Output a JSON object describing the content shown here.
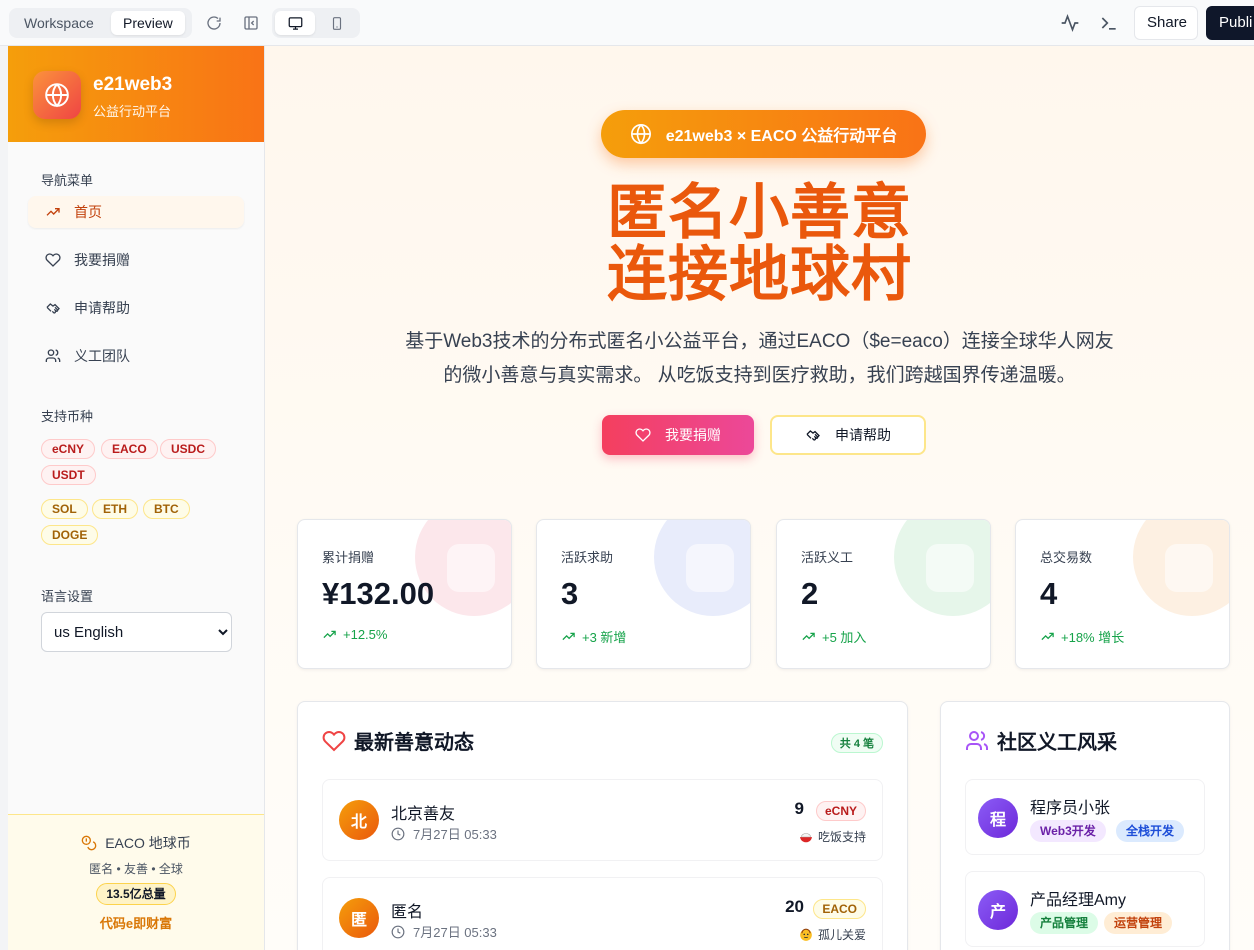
{
  "toolbar": {
    "workspace_label": "Workspace",
    "preview_label": "Preview",
    "share_label": "Share",
    "publish_label": "Publi"
  },
  "sidebar": {
    "brand_name": "e21web3",
    "brand_sub": "公益行动平台",
    "nav_heading": "导航菜单",
    "items": [
      {
        "label": "首页",
        "icon": "trending-up-icon"
      },
      {
        "label": "我要捐赠",
        "icon": "heart-icon"
      },
      {
        "label": "申请帮助",
        "icon": "handshake-icon"
      },
      {
        "label": "义工团队",
        "icon": "users-icon"
      }
    ],
    "currency_heading": "支持币种",
    "currencies_primary": [
      "eCNY",
      "EACO",
      "USDC",
      "USDT"
    ],
    "currencies_crypto": [
      "SOL",
      "ETH",
      "BTC",
      "DOGE"
    ],
    "language_heading": "语言设置",
    "language_value": "us English",
    "footer": {
      "title": "EACO 地球币",
      "subtitle": "匿名 • 友善 • 全球",
      "badge": "13.5亿总量",
      "slogan": "代码e即财富"
    }
  },
  "hero": {
    "pill_text": "e21web3 × EACO 公益行动平台",
    "title_line1": "匿名小善意",
    "title_line2": "连接地球村",
    "desc_line1": "基于Web3技术的分布式匿名小公益平台，通过EACO（$e=eaco）连接全球华人网友",
    "desc_line2": "的微小善意与真实需求。 从吃饭支持到医疗救助，我们跨越国界传递温暖。",
    "donate_button": "我要捐赠",
    "help_button": "申请帮助"
  },
  "stats": [
    {
      "label": "累计捐赠",
      "value": "¥132.00",
      "change": "+12.5%",
      "color": "#fce7eb"
    },
    {
      "label": "活跃求助",
      "value": "3",
      "change": "+3 新增",
      "color": "#e8ecfb"
    },
    {
      "label": "活跃义工",
      "value": "2",
      "change": "+5 加入",
      "color": "#e6f6ea"
    },
    {
      "label": "总交易数",
      "value": "4",
      "change": "+18% 增长",
      "color": "#fdf0e2"
    }
  ],
  "donations": {
    "title": "最新善意动态",
    "count_badge": "共 4 笔",
    "items": [
      {
        "avatar": "北",
        "name": "北京善友",
        "time": "7月27日 05:33",
        "amount": "9",
        "currency": "eCNY",
        "category": "吃饭支持",
        "category_icon": "bowl-icon"
      },
      {
        "avatar": "匿",
        "name": "匿名",
        "time": "7月27日 05:33",
        "amount": "20",
        "currency": "EACO",
        "category": "孤儿关爱",
        "category_icon": "child-icon"
      }
    ]
  },
  "volunteers": {
    "title": "社区义工风采",
    "items": [
      {
        "avatar": "程",
        "name": "程序员小张",
        "tags": [
          "Web3开发",
          "全栈开发"
        ]
      },
      {
        "avatar": "产",
        "name": "产品经理Amy",
        "tags": [
          "产品管理",
          "运营管理"
        ]
      }
    ]
  },
  "colors": {
    "accent": "#f97316",
    "brand_orange": "#ea580c",
    "donate_pink": "#f43f5e",
    "success": "#16a34a",
    "volunteer_purple": "#7c3aed"
  }
}
